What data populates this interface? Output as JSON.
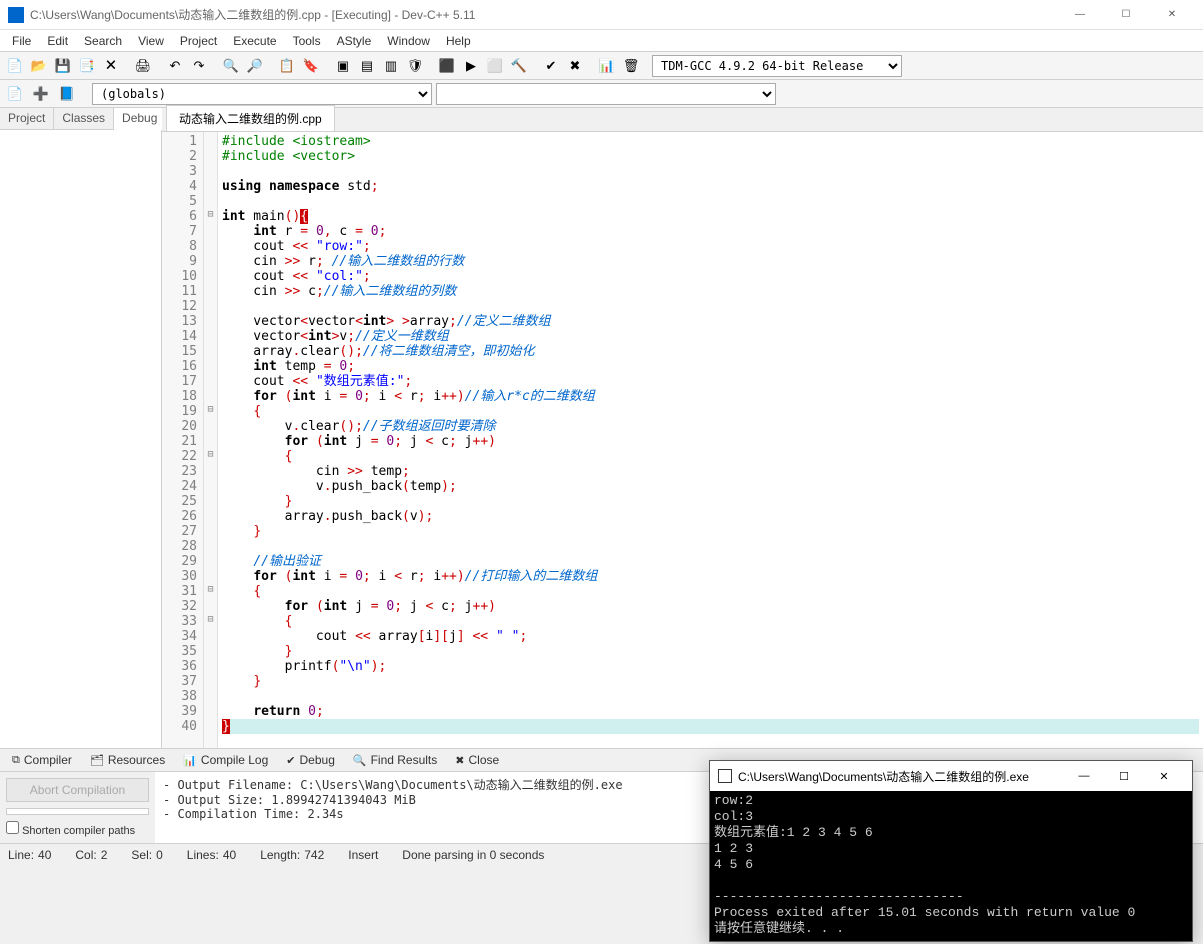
{
  "window": {
    "title": "C:\\Users\\Wang\\Documents\\动态输入二维数组的例.cpp - [Executing] - Dev-C++ 5.11"
  },
  "menu": [
    "File",
    "Edit",
    "Search",
    "View",
    "Project",
    "Execute",
    "Tools",
    "AStyle",
    "Window",
    "Help"
  ],
  "compiler_select": "TDM-GCC 4.9.2 64-bit Release",
  "globals": "(globals)",
  "left_tabs": [
    "Project",
    "Classes",
    "Debug"
  ],
  "active_left_tab": 2,
  "file_tab": "动态输入二维数组的例.cpp",
  "code_lines": [
    {
      "n": 1,
      "fold": "",
      "t": [
        {
          "c": "pp",
          "s": "#include <iostream>"
        }
      ]
    },
    {
      "n": 2,
      "fold": "",
      "t": [
        {
          "c": "pp",
          "s": "#include <vector>"
        }
      ]
    },
    {
      "n": 3,
      "fold": "",
      "t": []
    },
    {
      "n": 4,
      "fold": "",
      "t": [
        {
          "c": "kw",
          "s": "using namespace"
        },
        {
          "c": "",
          "s": " std"
        },
        {
          "c": "op",
          "s": ";"
        }
      ]
    },
    {
      "n": 5,
      "fold": "",
      "t": []
    },
    {
      "n": 6,
      "fold": "⊟",
      "t": [
        {
          "c": "kw",
          "s": "int"
        },
        {
          "c": "",
          "s": " main"
        },
        {
          "c": "op",
          "s": "()"
        },
        {
          "c": "brace-hl",
          "s": "{"
        }
      ]
    },
    {
      "n": 7,
      "fold": "",
      "t": [
        {
          "c": "",
          "s": "    "
        },
        {
          "c": "kw",
          "s": "int"
        },
        {
          "c": "",
          "s": " r "
        },
        {
          "c": "op",
          "s": "="
        },
        {
          "c": "",
          "s": " "
        },
        {
          "c": "num",
          "s": "0"
        },
        {
          "c": "op",
          "s": ","
        },
        {
          "c": "",
          "s": " c "
        },
        {
          "c": "op",
          "s": "="
        },
        {
          "c": "",
          "s": " "
        },
        {
          "c": "num",
          "s": "0"
        },
        {
          "c": "op",
          "s": ";"
        }
      ]
    },
    {
      "n": 8,
      "fold": "",
      "t": [
        {
          "c": "",
          "s": "    cout "
        },
        {
          "c": "op",
          "s": "<<"
        },
        {
          "c": "",
          "s": " "
        },
        {
          "c": "str",
          "s": "\"row:\""
        },
        {
          "c": "op",
          "s": ";"
        }
      ]
    },
    {
      "n": 9,
      "fold": "",
      "t": [
        {
          "c": "",
          "s": "    cin "
        },
        {
          "c": "op",
          "s": ">>"
        },
        {
          "c": "",
          "s": " r"
        },
        {
          "c": "op",
          "s": ";"
        },
        {
          "c": "",
          "s": " "
        },
        {
          "c": "cmt",
          "s": "//输入二维数组的行数"
        }
      ]
    },
    {
      "n": 10,
      "fold": "",
      "t": [
        {
          "c": "",
          "s": "    cout "
        },
        {
          "c": "op",
          "s": "<<"
        },
        {
          "c": "",
          "s": " "
        },
        {
          "c": "str",
          "s": "\"col:\""
        },
        {
          "c": "op",
          "s": ";"
        }
      ]
    },
    {
      "n": 11,
      "fold": "",
      "t": [
        {
          "c": "",
          "s": "    cin "
        },
        {
          "c": "op",
          "s": ">>"
        },
        {
          "c": "",
          "s": " c"
        },
        {
          "c": "op",
          "s": ";"
        },
        {
          "c": "cmt",
          "s": "//输入二维数组的列数"
        }
      ]
    },
    {
      "n": 12,
      "fold": "",
      "t": []
    },
    {
      "n": 13,
      "fold": "",
      "t": [
        {
          "c": "",
          "s": "    vector"
        },
        {
          "c": "op",
          "s": "<"
        },
        {
          "c": "",
          "s": "vector"
        },
        {
          "c": "op",
          "s": "<"
        },
        {
          "c": "kw",
          "s": "int"
        },
        {
          "c": "op",
          "s": ">"
        },
        {
          "c": "",
          "s": " "
        },
        {
          "c": "op",
          "s": ">"
        },
        {
          "c": "",
          "s": "array"
        },
        {
          "c": "op",
          "s": ";"
        },
        {
          "c": "cmt",
          "s": "//定义二维数组"
        }
      ]
    },
    {
      "n": 14,
      "fold": "",
      "t": [
        {
          "c": "",
          "s": "    vector"
        },
        {
          "c": "op",
          "s": "<"
        },
        {
          "c": "kw",
          "s": "int"
        },
        {
          "c": "op",
          "s": ">"
        },
        {
          "c": "",
          "s": "v"
        },
        {
          "c": "op",
          "s": ";"
        },
        {
          "c": "cmt",
          "s": "//定义一维数组"
        }
      ]
    },
    {
      "n": 15,
      "fold": "",
      "t": [
        {
          "c": "",
          "s": "    array"
        },
        {
          "c": "op",
          "s": "."
        },
        {
          "c": "",
          "s": "clear"
        },
        {
          "c": "op",
          "s": "();"
        },
        {
          "c": "cmt",
          "s": "//将二维数组清空，即初始化"
        }
      ]
    },
    {
      "n": 16,
      "fold": "",
      "t": [
        {
          "c": "",
          "s": "    "
        },
        {
          "c": "kw",
          "s": "int"
        },
        {
          "c": "",
          "s": " temp "
        },
        {
          "c": "op",
          "s": "="
        },
        {
          "c": "",
          "s": " "
        },
        {
          "c": "num",
          "s": "0"
        },
        {
          "c": "op",
          "s": ";"
        }
      ]
    },
    {
      "n": 17,
      "fold": "",
      "t": [
        {
          "c": "",
          "s": "    cout "
        },
        {
          "c": "op",
          "s": "<<"
        },
        {
          "c": "",
          "s": " "
        },
        {
          "c": "str",
          "s": "\"数组元素值:\""
        },
        {
          "c": "op",
          "s": ";"
        }
      ]
    },
    {
      "n": 18,
      "fold": "",
      "t": [
        {
          "c": "",
          "s": "    "
        },
        {
          "c": "kw",
          "s": "for"
        },
        {
          "c": "",
          "s": " "
        },
        {
          "c": "op",
          "s": "("
        },
        {
          "c": "kw",
          "s": "int"
        },
        {
          "c": "",
          "s": " i "
        },
        {
          "c": "op",
          "s": "="
        },
        {
          "c": "",
          "s": " "
        },
        {
          "c": "num",
          "s": "0"
        },
        {
          "c": "op",
          "s": ";"
        },
        {
          "c": "",
          "s": " i "
        },
        {
          "c": "op",
          "s": "<"
        },
        {
          "c": "",
          "s": " r"
        },
        {
          "c": "op",
          "s": ";"
        },
        {
          "c": "",
          "s": " i"
        },
        {
          "c": "op",
          "s": "++)"
        },
        {
          "c": "cmt",
          "s": "//输入r*c的二维数组"
        }
      ]
    },
    {
      "n": 19,
      "fold": "⊟",
      "t": [
        {
          "c": "",
          "s": "    "
        },
        {
          "c": "op",
          "s": "{"
        }
      ]
    },
    {
      "n": 20,
      "fold": "",
      "t": [
        {
          "c": "",
          "s": "        v"
        },
        {
          "c": "op",
          "s": "."
        },
        {
          "c": "",
          "s": "clear"
        },
        {
          "c": "op",
          "s": "();"
        },
        {
          "c": "cmt",
          "s": "//子数组返回时要清除"
        }
      ]
    },
    {
      "n": 21,
      "fold": "",
      "t": [
        {
          "c": "",
          "s": "        "
        },
        {
          "c": "kw",
          "s": "for"
        },
        {
          "c": "",
          "s": " "
        },
        {
          "c": "op",
          "s": "("
        },
        {
          "c": "kw",
          "s": "int"
        },
        {
          "c": "",
          "s": " j "
        },
        {
          "c": "op",
          "s": "="
        },
        {
          "c": "",
          "s": " "
        },
        {
          "c": "num",
          "s": "0"
        },
        {
          "c": "op",
          "s": ";"
        },
        {
          "c": "",
          "s": " j "
        },
        {
          "c": "op",
          "s": "<"
        },
        {
          "c": "",
          "s": " c"
        },
        {
          "c": "op",
          "s": ";"
        },
        {
          "c": "",
          "s": " j"
        },
        {
          "c": "op",
          "s": "++)"
        }
      ]
    },
    {
      "n": 22,
      "fold": "⊟",
      "t": [
        {
          "c": "",
          "s": "        "
        },
        {
          "c": "op",
          "s": "{"
        }
      ]
    },
    {
      "n": 23,
      "fold": "",
      "t": [
        {
          "c": "",
          "s": "            cin "
        },
        {
          "c": "op",
          "s": ">>"
        },
        {
          "c": "",
          "s": " temp"
        },
        {
          "c": "op",
          "s": ";"
        }
      ]
    },
    {
      "n": 24,
      "fold": "",
      "t": [
        {
          "c": "",
          "s": "            v"
        },
        {
          "c": "op",
          "s": "."
        },
        {
          "c": "",
          "s": "push_back"
        },
        {
          "c": "op",
          "s": "("
        },
        {
          "c": "",
          "s": "temp"
        },
        {
          "c": "op",
          "s": ");"
        }
      ]
    },
    {
      "n": 25,
      "fold": "",
      "t": [
        {
          "c": "",
          "s": "        "
        },
        {
          "c": "op",
          "s": "}"
        }
      ]
    },
    {
      "n": 26,
      "fold": "",
      "t": [
        {
          "c": "",
          "s": "        array"
        },
        {
          "c": "op",
          "s": "."
        },
        {
          "c": "",
          "s": "push_back"
        },
        {
          "c": "op",
          "s": "("
        },
        {
          "c": "",
          "s": "v"
        },
        {
          "c": "op",
          "s": ");"
        }
      ]
    },
    {
      "n": 27,
      "fold": "",
      "t": [
        {
          "c": "",
          "s": "    "
        },
        {
          "c": "op",
          "s": "}"
        }
      ]
    },
    {
      "n": 28,
      "fold": "",
      "t": []
    },
    {
      "n": 29,
      "fold": "",
      "t": [
        {
          "c": "",
          "s": "    "
        },
        {
          "c": "cmt",
          "s": "//输出验证"
        }
      ]
    },
    {
      "n": 30,
      "fold": "",
      "t": [
        {
          "c": "",
          "s": "    "
        },
        {
          "c": "kw",
          "s": "for"
        },
        {
          "c": "",
          "s": " "
        },
        {
          "c": "op",
          "s": "("
        },
        {
          "c": "kw",
          "s": "int"
        },
        {
          "c": "",
          "s": " i "
        },
        {
          "c": "op",
          "s": "="
        },
        {
          "c": "",
          "s": " "
        },
        {
          "c": "num",
          "s": "0"
        },
        {
          "c": "op",
          "s": ";"
        },
        {
          "c": "",
          "s": " i "
        },
        {
          "c": "op",
          "s": "<"
        },
        {
          "c": "",
          "s": " r"
        },
        {
          "c": "op",
          "s": ";"
        },
        {
          "c": "",
          "s": " i"
        },
        {
          "c": "op",
          "s": "++)"
        },
        {
          "c": "cmt",
          "s": "//打印输入的二维数组"
        }
      ]
    },
    {
      "n": 31,
      "fold": "⊟",
      "t": [
        {
          "c": "",
          "s": "    "
        },
        {
          "c": "op",
          "s": "{"
        }
      ]
    },
    {
      "n": 32,
      "fold": "",
      "t": [
        {
          "c": "",
          "s": "        "
        },
        {
          "c": "kw",
          "s": "for"
        },
        {
          "c": "",
          "s": " "
        },
        {
          "c": "op",
          "s": "("
        },
        {
          "c": "kw",
          "s": "int"
        },
        {
          "c": "",
          "s": " j "
        },
        {
          "c": "op",
          "s": "="
        },
        {
          "c": "",
          "s": " "
        },
        {
          "c": "num",
          "s": "0"
        },
        {
          "c": "op",
          "s": ";"
        },
        {
          "c": "",
          "s": " j "
        },
        {
          "c": "op",
          "s": "<"
        },
        {
          "c": "",
          "s": " c"
        },
        {
          "c": "op",
          "s": ";"
        },
        {
          "c": "",
          "s": " j"
        },
        {
          "c": "op",
          "s": "++)"
        }
      ]
    },
    {
      "n": 33,
      "fold": "⊟",
      "t": [
        {
          "c": "",
          "s": "        "
        },
        {
          "c": "op",
          "s": "{"
        }
      ]
    },
    {
      "n": 34,
      "fold": "",
      "t": [
        {
          "c": "",
          "s": "            cout "
        },
        {
          "c": "op",
          "s": "<<"
        },
        {
          "c": "",
          "s": " array"
        },
        {
          "c": "op",
          "s": "["
        },
        {
          "c": "",
          "s": "i"
        },
        {
          "c": "op",
          "s": "]["
        },
        {
          "c": "",
          "s": "j"
        },
        {
          "c": "op",
          "s": "]"
        },
        {
          "c": "",
          "s": " "
        },
        {
          "c": "op",
          "s": "<<"
        },
        {
          "c": "",
          "s": " "
        },
        {
          "c": "str",
          "s": "\" \""
        },
        {
          "c": "op",
          "s": ";"
        }
      ]
    },
    {
      "n": 35,
      "fold": "",
      "t": [
        {
          "c": "",
          "s": "        "
        },
        {
          "c": "op",
          "s": "}"
        }
      ]
    },
    {
      "n": 36,
      "fold": "",
      "t": [
        {
          "c": "",
          "s": "        printf"
        },
        {
          "c": "op",
          "s": "("
        },
        {
          "c": "str",
          "s": "\"\\n\""
        },
        {
          "c": "op",
          "s": ");"
        }
      ]
    },
    {
      "n": 37,
      "fold": "",
      "t": [
        {
          "c": "",
          "s": "    "
        },
        {
          "c": "op",
          "s": "}"
        }
      ]
    },
    {
      "n": 38,
      "fold": "",
      "t": []
    },
    {
      "n": 39,
      "fold": "",
      "t": [
        {
          "c": "",
          "s": "    "
        },
        {
          "c": "kw",
          "s": "return"
        },
        {
          "c": "",
          "s": " "
        },
        {
          "c": "num",
          "s": "0"
        },
        {
          "c": "op",
          "s": ";"
        }
      ]
    },
    {
      "n": 40,
      "fold": "",
      "hl": true,
      "t": [
        {
          "c": "brace-hl",
          "s": "}"
        }
      ]
    }
  ],
  "bottom_tabs": [
    {
      "icon": "⧉",
      "label": "Compiler"
    },
    {
      "icon": "🗂",
      "label": "Resources"
    },
    {
      "icon": "📊",
      "label": "Compile Log"
    },
    {
      "icon": "✔",
      "label": "Debug"
    },
    {
      "icon": "🔍",
      "label": "Find Results"
    },
    {
      "icon": "✖",
      "label": "Close"
    }
  ],
  "abort_label": "Abort Compilation",
  "shorten_label": "Shorten compiler paths",
  "compile_output": "- Output Filename: C:\\Users\\Wang\\Documents\\动态输入二维数组的例.exe\n- Output Size: 1.89942741394043 MiB\n- Compilation Time: 2.34s",
  "status": {
    "line_lbl": "Line:",
    "line": "40",
    "col_lbl": "Col:",
    "col": "2",
    "sel_lbl": "Sel:",
    "sel": "0",
    "lines_lbl": "Lines:",
    "lines": "40",
    "length_lbl": "Length:",
    "length": "742",
    "mode": "Insert",
    "parse": "Done parsing in 0 seconds"
  },
  "console": {
    "title": "C:\\Users\\Wang\\Documents\\动态输入二维数组的例.exe",
    "body": "row:2\ncol:3\n数组元素值:1 2 3 4 5 6\n1 2 3\n4 5 6\n\n--------------------------------\nProcess exited after 15.01 seconds with return value 0\n请按任意键继续. . ."
  }
}
